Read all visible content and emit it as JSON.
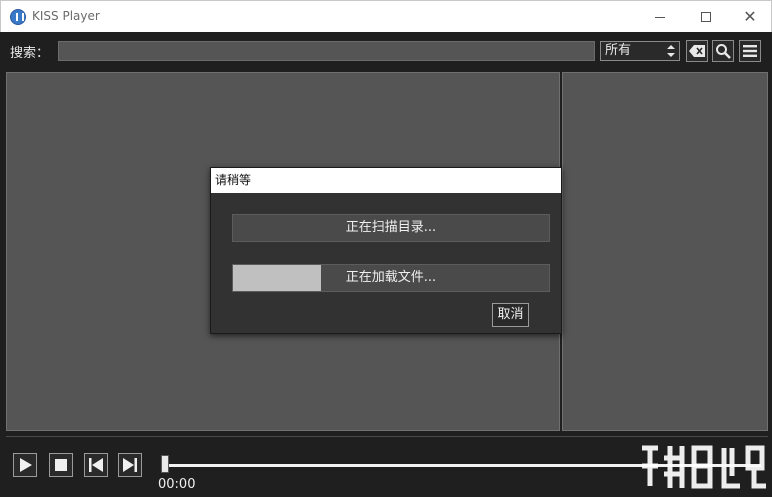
{
  "window": {
    "title": "KISS Player"
  },
  "toolbar": {
    "search_label": "搜索：",
    "search_value": "",
    "filter_selected": "所有"
  },
  "dialog": {
    "title": "请稍等",
    "scan_text": "正在扫描目录...",
    "scan_progress": 0,
    "load_text": "正在加载文件...",
    "load_progress": 0.28,
    "cancel_label": "取消"
  },
  "player": {
    "time": "00:00",
    "seek_position": 0
  },
  "icons": {
    "clear": "clear-icon",
    "search": "search-icon",
    "menu": "menu-icon",
    "play": "play-icon",
    "stop": "stop-icon",
    "prev": "skip-previous-icon",
    "next": "skip-next-icon"
  },
  "colors": {
    "background": "#1f1f1f",
    "panel": "#555555",
    "dialog": "#323232",
    "progress_fill": "#c0c0c0"
  }
}
